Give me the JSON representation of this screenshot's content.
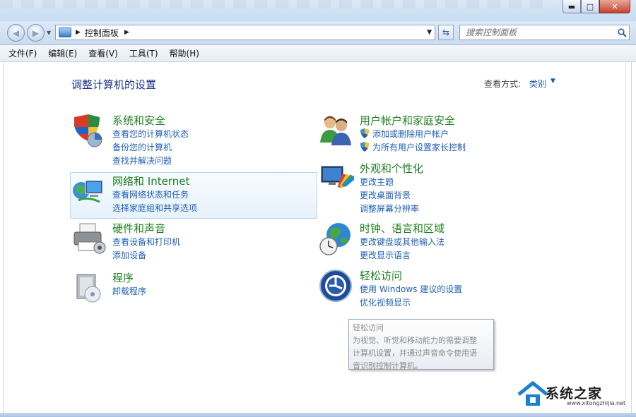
{
  "window": {
    "minimize_glyph": "▬",
    "maximize_glyph": "□",
    "close_glyph": "✕"
  },
  "address": {
    "breadcrumb": "控制面板",
    "search_placeholder": "搜索控制面板"
  },
  "menu": [
    "文件(F)",
    "编辑(E)",
    "查看(V)",
    "工具(T)",
    "帮助(H)"
  ],
  "page": {
    "title": "调整计算机的设置",
    "view_label": "查看方式:",
    "view_value": "类别"
  },
  "categories": {
    "system_security": {
      "title": "系统和安全",
      "links": [
        "查看您的计算机状态",
        "备份您的计算机",
        "查找并解决问题"
      ]
    },
    "network": {
      "title": "网络和 Internet",
      "links": [
        "查看网络状态和任务",
        "选择家庭组和共享选项"
      ]
    },
    "hardware": {
      "title": "硬件和声音",
      "links": [
        "查看设备和打印机",
        "添加设备"
      ]
    },
    "programs": {
      "title": "程序",
      "links": [
        "卸载程序"
      ]
    },
    "users": {
      "title": "用户帐户和家庭安全",
      "links": [
        "添加或删除用户帐户",
        "为所有用户设置家长控制"
      ]
    },
    "appearance": {
      "title": "外观和个性化",
      "links": [
        "更改主题",
        "更改桌面背景",
        "调整屏幕分辨率"
      ]
    },
    "clock": {
      "title": "时钟、语言和区域",
      "links": [
        "更改键盘或其他输入法",
        "更改显示语言"
      ]
    },
    "ease": {
      "title": "轻松访问",
      "links": [
        "使用 Windows 建议的设置",
        "优化视频显示"
      ]
    }
  },
  "tooltip": {
    "title": "轻松访问",
    "lines": [
      "为视觉、听觉和移动能力的需要调整",
      "计算机设置，并通过声音命令使用语",
      "音识别控制计算机。"
    ]
  },
  "watermark": {
    "text": "系统之家",
    "url": "www.xitongzhijia.net"
  },
  "colors": {
    "category_title": "#1f7f1f",
    "link": "#1f5fb5",
    "page_title": "#1e3287"
  }
}
